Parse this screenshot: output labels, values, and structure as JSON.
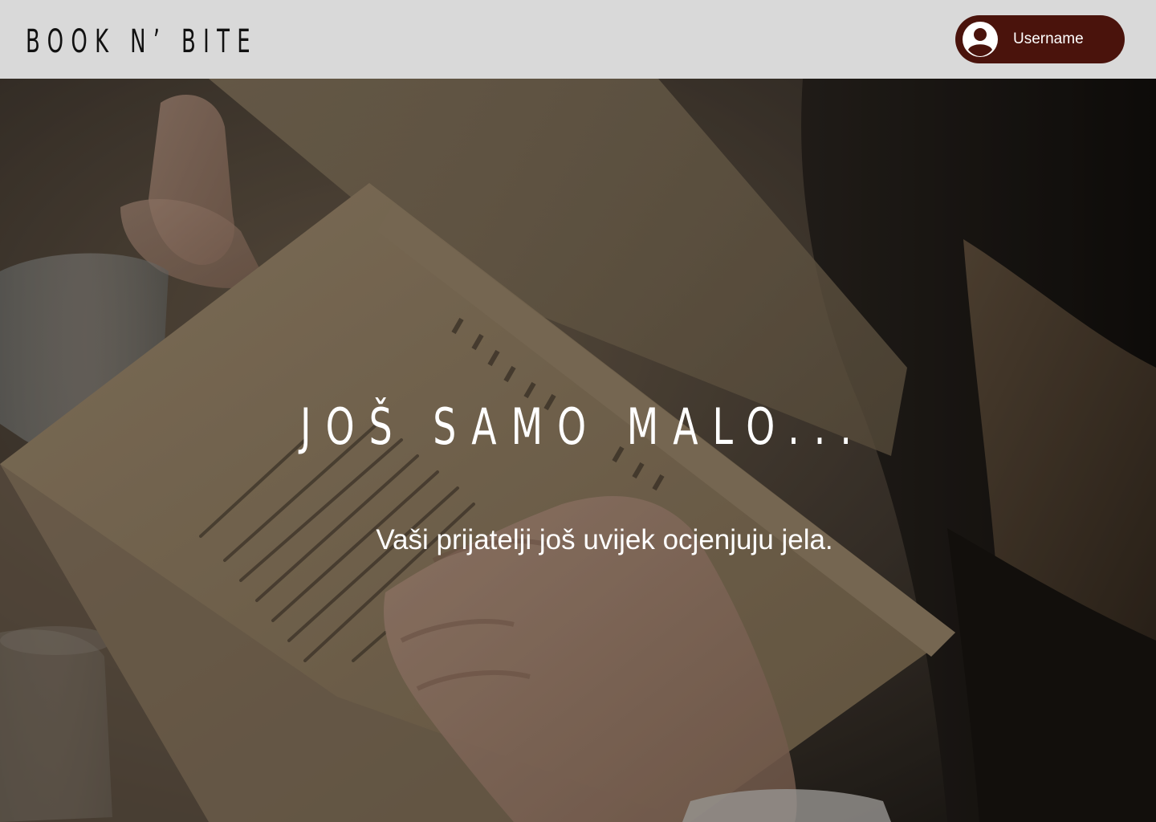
{
  "header": {
    "logo": "BOOK N’ BITE",
    "username": "Username",
    "avatar_icon": "account-circle-icon"
  },
  "hero": {
    "title": "JOŠ SAMO MALO...",
    "subtitle": "Vaši prijatelji još uvijek ocjenjuju jela."
  },
  "colors": {
    "header_bg": "#d9d9d9",
    "user_pill_bg": "#4a130c",
    "logo_text": "#111111",
    "hero_text": "#ffffff"
  }
}
